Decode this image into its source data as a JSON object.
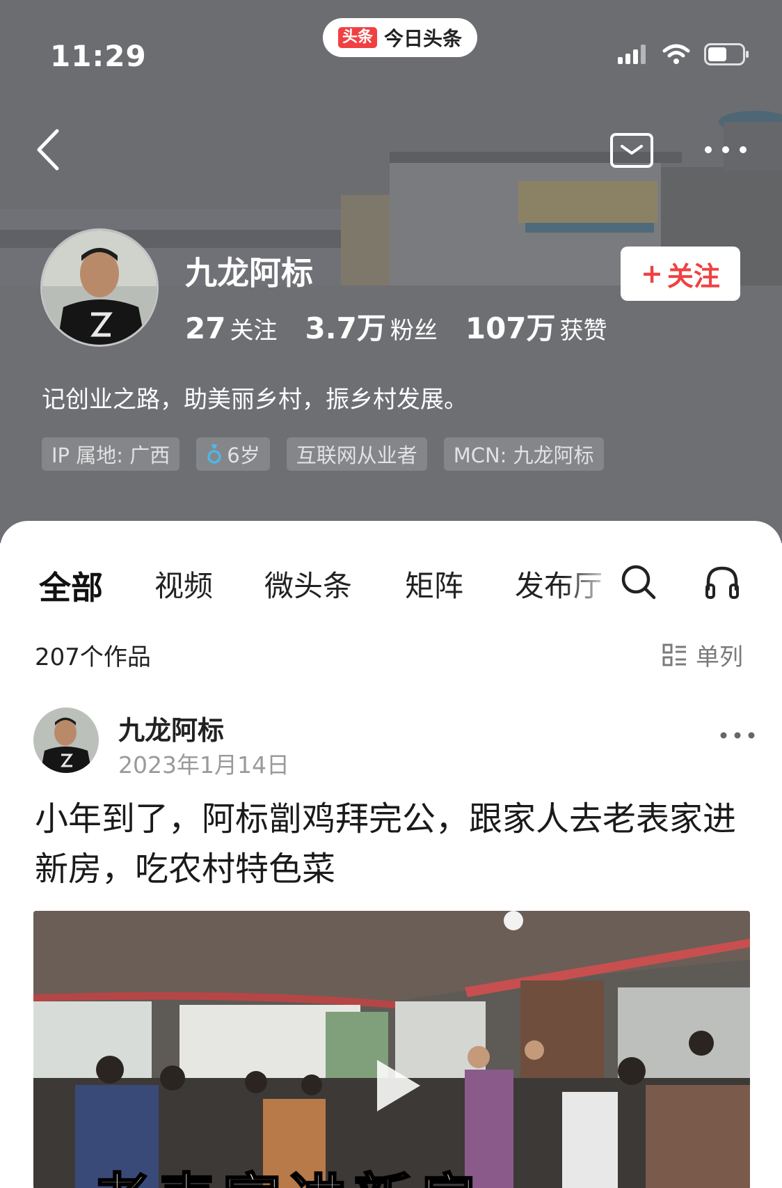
{
  "status_bar": {
    "time": "11:29",
    "app_badge_logo": "头条",
    "app_badge_name": "今日头条",
    "icons": [
      "signal-icon",
      "wifi-icon",
      "battery-icon"
    ]
  },
  "nav": {
    "back_icon": "chevron-left-icon",
    "message_icon": "message-box-icon",
    "more_icon": "more-dots-icon"
  },
  "profile": {
    "name": "九龙阿标",
    "stats": [
      {
        "num": "27",
        "label": "关注"
      },
      {
        "num": "3.7万",
        "label": "粉丝"
      },
      {
        "num": "107万",
        "label": "获赞"
      }
    ],
    "follow_label": "关注",
    "follow_plus": "+",
    "bio": "记创业之路，助美丽乡村，振乡村发展。",
    "tags": [
      "IP 属地: 广西",
      "6岁",
      "互联网从业者",
      "MCN: 九龙阿标"
    ]
  },
  "tabs": {
    "items": [
      "全部",
      "视频",
      "微头条",
      "矩阵",
      "发布厅"
    ],
    "active": "全部"
  },
  "list": {
    "works_count": "207个作品",
    "view_mode": "单列"
  },
  "post": {
    "author": "九龙阿标",
    "date": "2023年1月14日",
    "title": "小年到了，阿标劏鸡拜完公，跟家人去老表家进新房，吃农村特色菜",
    "video_caption": "老表家进新房"
  },
  "colors": {
    "accent": "#f04142",
    "cover_bg": "#6e6e72",
    "text_primary": "#222222",
    "text_secondary": "#9a9a9a"
  }
}
